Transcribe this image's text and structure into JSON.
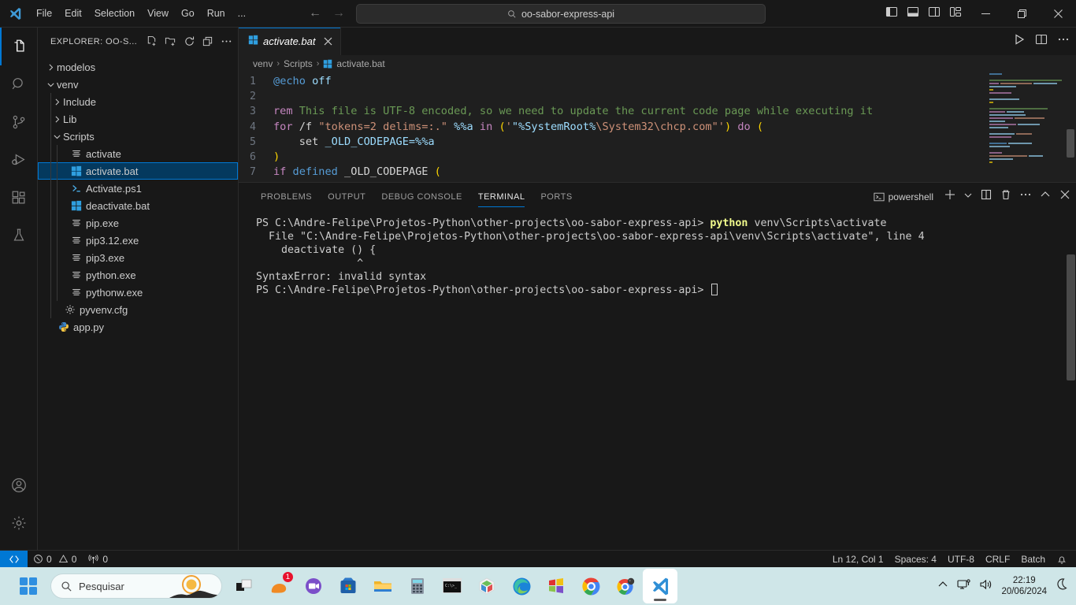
{
  "titlebar": {
    "menus": [
      "File",
      "Edit",
      "Selection",
      "View",
      "Go",
      "Run",
      "..."
    ],
    "search_value": "oo-sabor-express-api",
    "search_placeholder": "Search",
    "back_arrow": "←",
    "forward_arrow": "→",
    "minimize": "—",
    "restore": "❐",
    "close": "✕"
  },
  "sidebar": {
    "title": "EXPLORER: OO-S...",
    "tree": [
      {
        "label": "modelos",
        "icon": "chevron-right",
        "kind": "folder-collapsed",
        "indent": 1,
        "selected": false
      },
      {
        "label": "venv",
        "icon": "chevron-down",
        "kind": "folder-expanded",
        "indent": 1,
        "selected": false
      },
      {
        "label": "Include",
        "icon": "chevron-right",
        "kind": "folder-collapsed",
        "indent": 2,
        "selected": false
      },
      {
        "label": "Lib",
        "icon": "chevron-right",
        "kind": "folder-collapsed",
        "indent": 2,
        "selected": false
      },
      {
        "label": "Scripts",
        "icon": "chevron-down",
        "kind": "folder-expanded",
        "indent": 2,
        "selected": false
      },
      {
        "label": "activate",
        "icon": "",
        "kind": "file-plain",
        "indent": 3,
        "selected": false
      },
      {
        "label": "activate.bat",
        "icon": "",
        "kind": "file-bat",
        "indent": 3,
        "selected": true
      },
      {
        "label": "Activate.ps1",
        "icon": "",
        "kind": "file-ps1",
        "indent": 3,
        "selected": false
      },
      {
        "label": "deactivate.bat",
        "icon": "",
        "kind": "file-bat",
        "indent": 3,
        "selected": false
      },
      {
        "label": "pip.exe",
        "icon": "",
        "kind": "file-plain",
        "indent": 3,
        "selected": false
      },
      {
        "label": "pip3.12.exe",
        "icon": "",
        "kind": "file-plain",
        "indent": 3,
        "selected": false
      },
      {
        "label": "pip3.exe",
        "icon": "",
        "kind": "file-plain",
        "indent": 3,
        "selected": false
      },
      {
        "label": "python.exe",
        "icon": "",
        "kind": "file-plain",
        "indent": 3,
        "selected": false
      },
      {
        "label": "pythonw.exe",
        "icon": "",
        "kind": "file-plain",
        "indent": 3,
        "selected": false
      },
      {
        "label": "pyvenv.cfg",
        "icon": "",
        "kind": "file-cfg",
        "indent": 2,
        "selected": false
      },
      {
        "label": "app.py",
        "icon": "",
        "kind": "file-py",
        "indent": 1,
        "selected": false
      }
    ]
  },
  "editor": {
    "tab_label": "activate.bat",
    "breadcrumb": [
      "venv",
      "Scripts",
      "activate.bat"
    ],
    "lines": [
      {
        "n": "1",
        "tokens": [
          {
            "t": "@",
            "c": "#569cd6"
          },
          {
            "t": "echo",
            "c": "#569cd6"
          },
          {
            "t": " off",
            "c": "#9cdcfe"
          }
        ]
      },
      {
        "n": "2",
        "tokens": []
      },
      {
        "n": "3",
        "tokens": [
          {
            "t": "rem",
            "c": "#c586c0"
          },
          {
            "t": " This file is UTF-8 encoded, so we need to update the current code page while executing it",
            "c": "#6a9955"
          }
        ]
      },
      {
        "n": "4",
        "tokens": [
          {
            "t": "for",
            "c": "#c586c0"
          },
          {
            "t": " /f ",
            "c": "#d4d4d4"
          },
          {
            "t": "\"tokens=2 delims=:.\"",
            "c": "#ce9178"
          },
          {
            "t": " %%a",
            "c": "#9cdcfe"
          },
          {
            "t": " in",
            "c": "#c586c0"
          },
          {
            "t": " (",
            "c": "#ffd700"
          },
          {
            "t": "'",
            "c": "#ce9178"
          },
          {
            "t": "\"%SystemRoot%",
            "c": "#9cdcfe"
          },
          {
            "t": "\\System32\\chcp.com\"",
            "c": "#ce9178"
          },
          {
            "t": "'",
            "c": "#ce9178"
          },
          {
            "t": ")",
            "c": "#ffd700"
          },
          {
            "t": " do",
            "c": "#c586c0"
          },
          {
            "t": " (",
            "c": "#ffd700"
          }
        ]
      },
      {
        "n": "5",
        "tokens": [
          {
            "t": "    set",
            "c": "#d4d4d4"
          },
          {
            "t": " _OLD_CODEPAGE=%%a",
            "c": "#9cdcfe"
          }
        ]
      },
      {
        "n": "6",
        "tokens": [
          {
            "t": ")",
            "c": "#ffd700"
          }
        ]
      },
      {
        "n": "7",
        "tokens": [
          {
            "t": "if",
            "c": "#c586c0"
          },
          {
            "t": " defined",
            "c": "#569cd6"
          },
          {
            "t": " _OLD_CODEPAGE",
            "c": "#d4d4d4"
          },
          {
            "t": " (",
            "c": "#ffd700"
          }
        ]
      }
    ],
    "run_icon": "run-button",
    "split_icon": "split-editor-icon",
    "more_icon": "more-actions-icon"
  },
  "panel": {
    "tabs": [
      "PROBLEMS",
      "OUTPUT",
      "DEBUG CONSOLE",
      "TERMINAL",
      "PORTS"
    ],
    "active_tab": "TERMINAL",
    "terminal_name": "powershell",
    "terminal_lines": [
      {
        "segments": [
          {
            "t": "PS C:\\Andre-Felipe\\Projetos-Python\\other-projects\\oo-sabor-express-api> ",
            "c": "#cccccc"
          },
          {
            "t": "python",
            "c": "#f1fa8c",
            "b": true
          },
          {
            "t": " venv\\Scripts\\activate",
            "c": "#cccccc"
          }
        ]
      },
      {
        "segments": [
          {
            "t": "  File \"C:\\Andre-Felipe\\Projetos-Python\\other-projects\\oo-sabor-express-api\\venv\\Scripts\\activate\", line 4",
            "c": "#cccccc"
          }
        ]
      },
      {
        "segments": [
          {
            "t": "    deactivate () {",
            "c": "#cccccc"
          }
        ]
      },
      {
        "segments": [
          {
            "t": "                ^",
            "c": "#cccccc"
          }
        ]
      },
      {
        "segments": [
          {
            "t": "SyntaxError: invalid syntax",
            "c": "#cccccc"
          }
        ]
      },
      {
        "segments": [
          {
            "t": "PS C:\\Andre-Felipe\\Projetos-Python\\other-projects\\oo-sabor-express-api> ",
            "c": "#cccccc"
          }
        ],
        "cursor": true
      }
    ]
  },
  "statusbar": {
    "remote_icon": "remote-window-icon",
    "errors": "0",
    "warnings": "0",
    "ports": "0",
    "position": "Ln 12, Col 1",
    "spaces": "Spaces: 4",
    "encoding": "UTF-8",
    "eol": "CRLF",
    "language": "Batch",
    "bell": "notifications-bell-icon"
  },
  "taskbar": {
    "search_placeholder": "Pesquisar",
    "whatsapp_badge": "1",
    "time": "22:19",
    "date": "20/06/2024",
    "apps": [
      "start-button",
      "search-box",
      "task-view",
      "whatsapp",
      "teams",
      "microsoft-store",
      "file-explorer",
      "calculator",
      "terminal",
      "unity-hub",
      "microsoft-edge",
      "windows-icon-app",
      "google-chrome",
      "chrome-beta",
      "visual-studio-code"
    ]
  }
}
